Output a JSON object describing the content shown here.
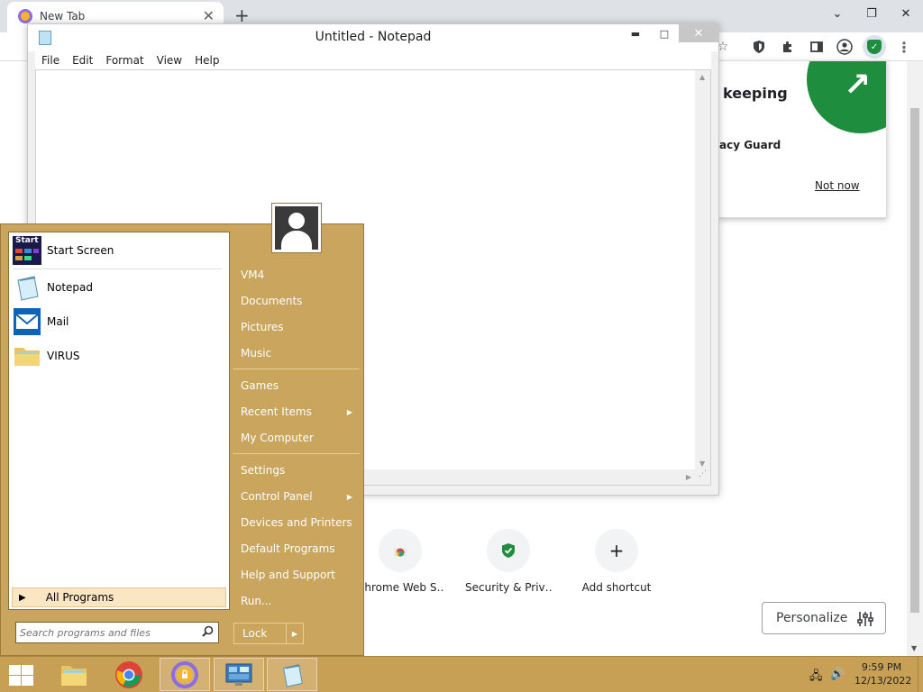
{
  "chrome": {
    "tab_title": "New Tab",
    "tab_close": "✕",
    "new_tab": "+",
    "min": "⌄",
    "restore": "❐",
    "close": "✕",
    "popup": {
      "heading": "keeping",
      "subheading": "acy Guard",
      "not_now": "Not now"
    },
    "shortcuts": [
      {
        "label": "Chrome Web S…",
        "icon": "chrome-web-store-icon"
      },
      {
        "label": "Security & Priv…",
        "icon": "security-shield-icon"
      },
      {
        "label": "Add shortcut",
        "icon": "plus-icon",
        "glyph": "+"
      }
    ],
    "personalize": "Personalize"
  },
  "notepad": {
    "title": "Untitled - Notepad",
    "menu": [
      "File",
      "Edit",
      "Format",
      "View",
      "Help"
    ],
    "min": "▬",
    "max": "□",
    "close": "✕"
  },
  "start_menu": {
    "programs": [
      {
        "label": "Start Screen",
        "icon": "start-screen-icon",
        "badge": "Start"
      },
      {
        "label": "Notepad",
        "icon": "notepad-icon"
      },
      {
        "label": "Mail",
        "icon": "mail-icon"
      },
      {
        "label": "VIRUS",
        "icon": "folder-icon"
      }
    ],
    "all_programs": "All Programs",
    "search_placeholder": "Search programs and files",
    "right_items": [
      "VM4",
      "Documents",
      "Pictures",
      "Music",
      "Games",
      "Recent Items",
      "My Computer",
      "Settings",
      "Control Panel",
      "Devices and Printers",
      "Default Programs",
      "Help and Support",
      "Run..."
    ],
    "lock": "Lock"
  },
  "taskbar": {
    "time": "9:59 PM",
    "date": "12/13/2022"
  }
}
